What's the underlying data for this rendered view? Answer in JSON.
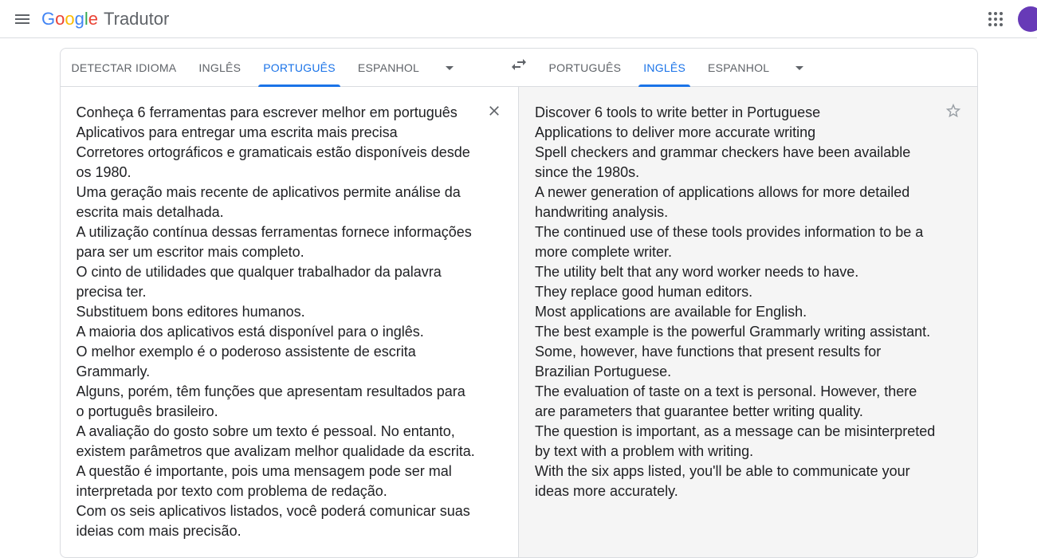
{
  "app": {
    "product_name": "Tradutor"
  },
  "source_tabs": {
    "detect": "Detectar idioma",
    "english": "Inglês",
    "portuguese": "Português",
    "spanish": "Espanhol",
    "active": "portuguese"
  },
  "target_tabs": {
    "portuguese": "Português",
    "english": "Inglês",
    "spanish": "Espanhol",
    "active": "english"
  },
  "source_text": "Conheça 6 ferramentas para escrever melhor em português\nAplicativos para entregar uma escrita mais precisa\nCorretores ortográficos e gramaticais estão disponíveis desde os 1980.\nUma geração mais recente de aplicativos permite análise da escrita mais detalhada.\nA utilização contínua dessas ferramentas fornece informações para ser um escritor mais completo.\nO cinto de utilidades que qualquer trabalhador da palavra precisa ter.\nSubstituem bons editores humanos.\nA maioria dos aplicativos está disponível para o inglês.\nO melhor exemplo é o poderoso assistente de escrita Grammarly.\nAlguns, porém, têm funções que apresentam resultados para o português brasileiro.\nA avaliação do gosto sobre um texto é pessoal. No entanto, existem parâmetros que avalizam melhor qualidade da escrita.\nA questão é importante, pois uma mensagem pode ser mal interpretada por texto com problema de redação.\nCom os seis aplicativos listados, você poderá comunicar suas ideias com mais precisão.",
  "target_text": "Discover 6 tools to write better in Portuguese\nApplications to deliver more accurate writing\nSpell checkers and grammar checkers have been available since the 1980s.\nA newer generation of applications allows for more detailed handwriting analysis.\nThe continued use of these tools provides information to be a more complete writer.\nThe utility belt that any word worker needs to have.\nThey replace good human editors.\nMost applications are available for English.\nThe best example is the powerful Grammarly writing assistant.\nSome, however, have functions that present results for Brazilian Portuguese.\nThe evaluation of taste on a text is personal. However, there are parameters that guarantee better writing quality.\nThe question is important, as a message can be misinterpreted by text with a problem with writing.\nWith the six apps listed, you'll be able to communicate your ideas more accurately."
}
